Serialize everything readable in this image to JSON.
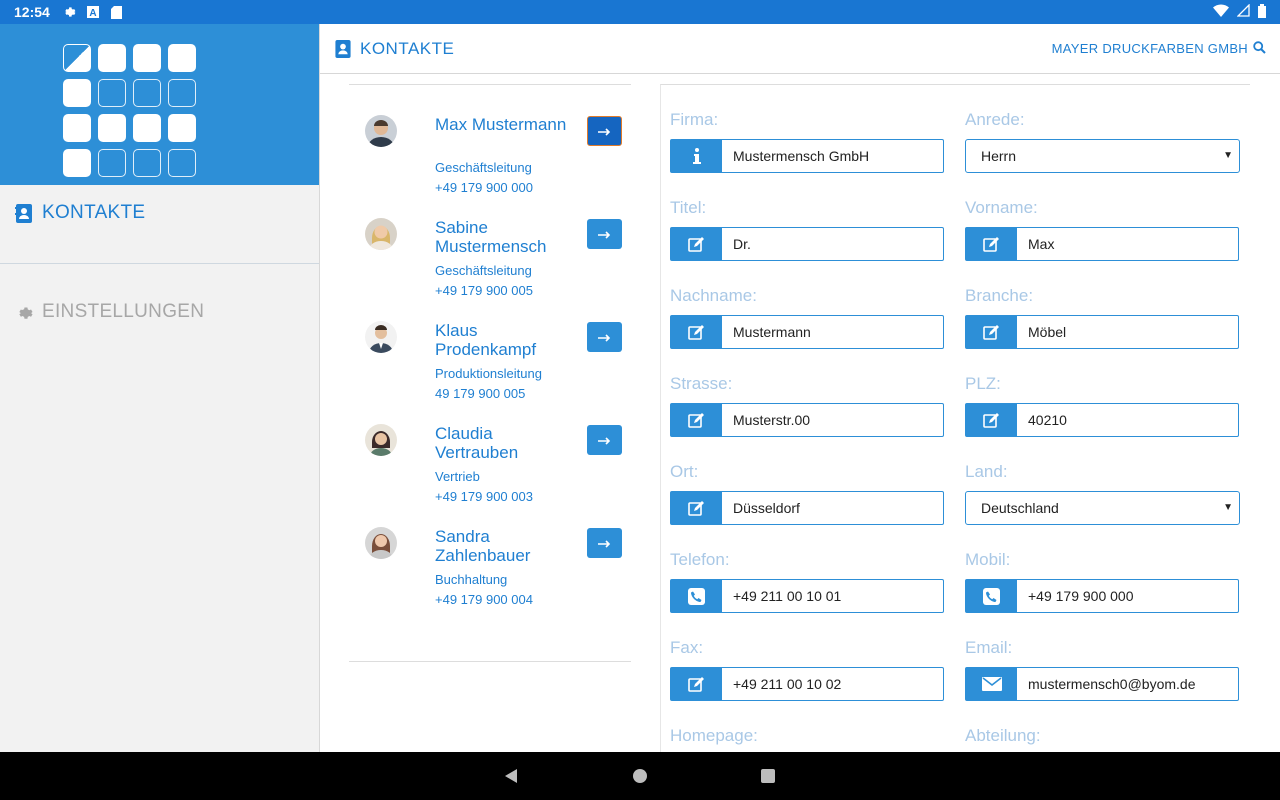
{
  "status_bar": {
    "time": "12:54",
    "left_icons": [
      "gear-icon",
      "font-a-icon",
      "sd-card-icon"
    ],
    "right_icons": [
      "wifi-icon",
      "signal-icon",
      "battery-icon"
    ]
  },
  "sidebar": {
    "items": [
      {
        "label": "KONTAKTE",
        "icon": "contacts-book-icon",
        "active": true
      },
      {
        "label": "EINSTELLUNGEN",
        "icon": "gear-icon",
        "active": false
      }
    ]
  },
  "header": {
    "title": "KONTAKTE",
    "company": "MAYER DRUCKFARBEN GMBH"
  },
  "contacts": [
    {
      "name": "Max Mustermann",
      "role": "Geschäftsleitung",
      "phone": "+49 179 900 000",
      "active": true
    },
    {
      "name": "Sabine Mustermensch",
      "role": "Geschäftsleitung",
      "phone": "+49 179 900 005",
      "active": false
    },
    {
      "name": "Klaus Prodenkampf",
      "role": "Produktionsleitung",
      "phone": "49 179 900 005",
      "active": false
    },
    {
      "name": "Claudia Vertrauben",
      "role": "Vertrieb",
      "phone": "+49 179 900 003",
      "active": false
    },
    {
      "name": "Sandra Zahlenbauer",
      "role": "Buchhaltung",
      "phone": "+49 179 900 004",
      "active": false
    }
  ],
  "form": {
    "firma": {
      "label": "Firma:",
      "value": "Mustermensch GmbH",
      "icon": "info-icon"
    },
    "anrede": {
      "label": "Anrede:",
      "value": "Herrn"
    },
    "titel": {
      "label": "Titel:",
      "value": "Dr.",
      "icon": "edit-icon"
    },
    "vorname": {
      "label": "Vorname:",
      "value": "Max",
      "icon": "edit-icon"
    },
    "nachname": {
      "label": "Nachname:",
      "value": "Mustermann",
      "icon": "edit-icon"
    },
    "branche": {
      "label": "Branche:",
      "value": "Möbel",
      "icon": "edit-icon"
    },
    "strasse": {
      "label": "Strasse:",
      "value": "Musterstr.00",
      "icon": "edit-icon"
    },
    "plz": {
      "label": "PLZ:",
      "value": "40210",
      "icon": "edit-icon"
    },
    "ort": {
      "label": "Ort:",
      "value": "Düsseldorf",
      "icon": "edit-icon"
    },
    "land": {
      "label": "Land:",
      "value": "Deutschland"
    },
    "telefon": {
      "label": "Telefon:",
      "value": "+49 211 00 10 01",
      "icon": "phone-icon"
    },
    "mobil": {
      "label": "Mobil:",
      "value": "+49 179 900 000",
      "icon": "phone-icon"
    },
    "fax": {
      "label": "Fax:",
      "value": "+49 211 00 10 02",
      "icon": "edit-icon"
    },
    "email": {
      "label": "Email:",
      "value": "mustermensch0@byom.de",
      "icon": "envelope-icon"
    },
    "homepage": {
      "label": "Homepage:"
    },
    "abteilung": {
      "label": "Abteilung:"
    }
  },
  "colors": {
    "primary": "#2d8fd7",
    "statusbar": "#1976d2",
    "label": "#a9c8e6",
    "active_button": "#1565c0",
    "active_border": "#e07b2a"
  }
}
